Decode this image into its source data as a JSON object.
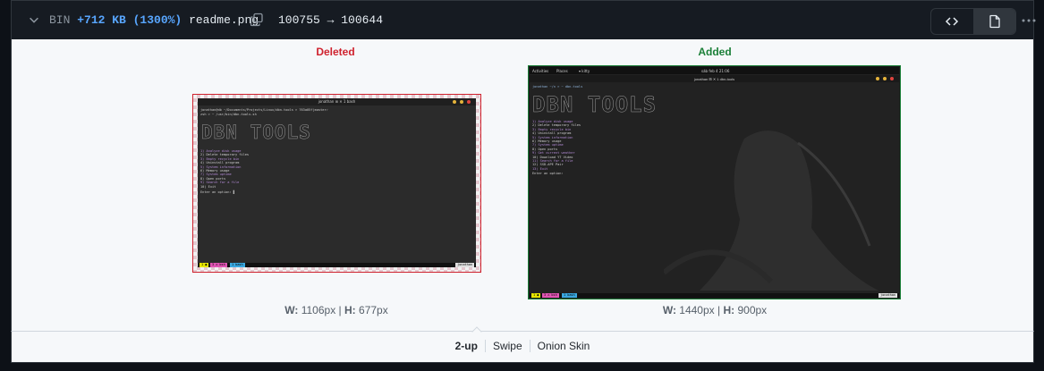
{
  "file": {
    "kind": "BIN",
    "size_delta": "+712 KB (1300%)",
    "name": "readme.png",
    "mode_change": "100755 → 100644"
  },
  "icons": {
    "collapse": "chevron-down-icon",
    "copy": "copy-icon",
    "source_view": "code-icon",
    "rich_view": "file-icon",
    "more": "kebab-horizontal-icon"
  },
  "colors": {
    "deleted": "#cf222e",
    "added": "#1a7f37",
    "link": "#58a6ff"
  },
  "deleted": {
    "label": "Deleted",
    "width_label": "W:",
    "width_value": "1106px",
    "height_label": "H:",
    "height_value": "677px",
    "terminal": {
      "title": "jonathan ⊞ ✕ 1 bash",
      "prompt": "jonathan@db ~/Documents/Projects/Linux/dbn-tools > 763a05f|master✓",
      "cmd": "zsh > ~ /usr/bin/dbn-tools.sh",
      "banner": "DBN TOOLS",
      "menu": [
        "1) Analyze disk usage",
        "2) Delete temporary files",
        "3) Empty recycle bin",
        "4) Uninstall program",
        "5) System information",
        "6) Memory usage",
        "7) System uptime",
        "8) Open ports",
        "9) Search for a file",
        "10) Exit"
      ],
      "input": "Enter an option: ▌",
      "status": [
        "1 ●",
        "3 ⌂ bsh",
        "1 bash"
      ],
      "status_right": "jonathan"
    }
  },
  "added": {
    "label": "Added",
    "width_label": "W:",
    "width_value": "1440px",
    "height_label": "H:",
    "height_value": "900px",
    "terminal": {
      "panel_left": [
        "Activities",
        "Places",
        "▾ kitty"
      ],
      "panel_center": "sáb feb 4 21:06",
      "title": "jonathan ⊞ ✕ 1 dbn-tools",
      "prompt": "jonathan ~/n > ~ dbn-tools",
      "banner": "DBN TOOLS",
      "menu": [
        "1) Analyze disk usage",
        "2) Delete temporary files",
        "3) Empty recycle bin",
        "4) Uninstall program",
        "5) System information",
        "6) Memory usage",
        "7) System uptime",
        "8) Open ports",
        "9) Get current weather",
        "10) Download YT Video",
        "11) Search for a file",
        "12) SSD-APE Pair",
        "13) Exit"
      ],
      "input": "Enter an option:",
      "status": [
        "1 ●",
        "3 ⌂ bsh",
        "1 bash"
      ],
      "status_right": "jonathan"
    }
  },
  "view_modes": {
    "selected": "2-up",
    "items": [
      "2-up",
      "Swipe",
      "Onion Skin"
    ]
  }
}
